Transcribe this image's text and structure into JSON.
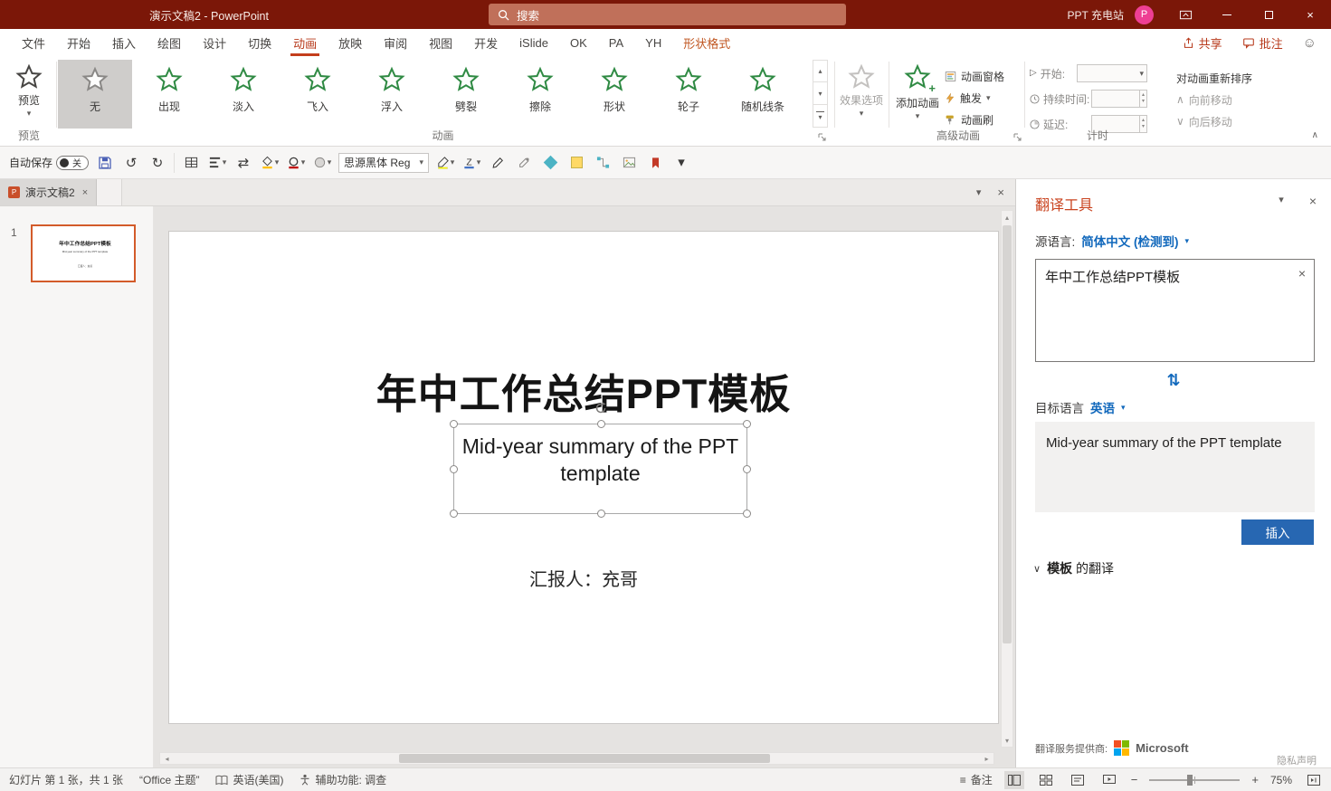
{
  "colors": {
    "titlebar": "#7b1708",
    "accent": "#c43e1c",
    "link_blue": "#1168bc",
    "insert_button": "#2767b2",
    "star_green": "#2f8a43",
    "avatar_pink": "#ee3f94",
    "selected_thumb_border": "#d35b2a",
    "ms_red": "#f25022",
    "ms_green": "#7fba00",
    "ms_blue": "#00a4ef",
    "ms_yellow": "#ffb900"
  },
  "icons": {
    "dropdown": "▾",
    "up_small": "▴",
    "left_arrow": "◂",
    "right_arrow": "▸",
    "close": "×",
    "undo": "↺",
    "redo": "↻",
    "swap_h": "⇄",
    "swap_v": "⇅",
    "chevron_up": "∧",
    "chevron_down": "∨",
    "play": "▷",
    "smiley": "☺",
    "notes": "≡",
    "minus": "−",
    "plus": "+"
  },
  "titlebar": {
    "title": "演示文稿2 - PowerPoint",
    "search_placeholder": "搜索",
    "account_name": "PPT 充电站",
    "avatar_initial": "P"
  },
  "ribbon_tabs": {
    "items": [
      "文件",
      "开始",
      "插入",
      "绘图",
      "设计",
      "切换",
      "动画",
      "放映",
      "审阅",
      "视图",
      "开发",
      "iSlide",
      "OK",
      "PA",
      "YH",
      "形状格式"
    ],
    "active_tab": "动画",
    "share": "共享",
    "comments": "批注"
  },
  "ribbon": {
    "preview": {
      "label": "预览"
    },
    "gallery": {
      "items": [
        {
          "label": "无"
        },
        {
          "label": "出现"
        },
        {
          "label": "淡入"
        },
        {
          "label": "飞入"
        },
        {
          "label": "浮入"
        },
        {
          "label": "劈裂"
        },
        {
          "label": "擦除"
        },
        {
          "label": "形状"
        },
        {
          "label": "轮子"
        },
        {
          "label": "随机线条"
        }
      ]
    },
    "effect_options": "效果选项",
    "add_animation": "添加动画",
    "animation_pane": "动画窗格",
    "trigger": "触发",
    "animation_painter": "动画刷",
    "timing": {
      "start_label": "开始:",
      "duration_label": "持续时间:",
      "delay_label": "延迟:"
    },
    "reorder": {
      "title": "对动画重新排序",
      "move_earlier": "向前移动",
      "move_later": "向后移动"
    },
    "sections": {
      "preview": "预览",
      "animation": "动画",
      "advanced": "高级动画",
      "timing": "计时"
    }
  },
  "toolbar": {
    "autosave_label": "自动保存",
    "autosave_state": "关",
    "font_name": "思源黑体 Reg"
  },
  "doc_tabs": {
    "tab1": "演示文稿2"
  },
  "thumbnails": {
    "slide1_number": "1"
  },
  "slide": {
    "title": "年中工作总结PPT模板",
    "subtitle": "Mid-year summary of the PPT template",
    "presenter": "汇报人：充哥"
  },
  "translator": {
    "title": "翻译工具",
    "source_label": "源语言:",
    "source_lang": "简体中文 (检测到)",
    "source_text": "年中工作总结PPT模板",
    "target_label": "目标语言",
    "target_lang": "英语",
    "result_text": "Mid-year summary of the PPT template",
    "insert_label": "插入",
    "expand_word": "模板",
    "expand_suffix": "的翻译",
    "provider_label": "翻译服务提供商:",
    "provider_name": "Microsoft",
    "privacy_label": "隐私声明"
  },
  "statusbar": {
    "slide_info": "幻灯片 第 1 张，共 1 张",
    "theme": "“Office 主题”",
    "language": "英语(美国)",
    "accessibility": "辅助功能: 调查",
    "notes_label": "备注",
    "zoom_level": "75%"
  }
}
